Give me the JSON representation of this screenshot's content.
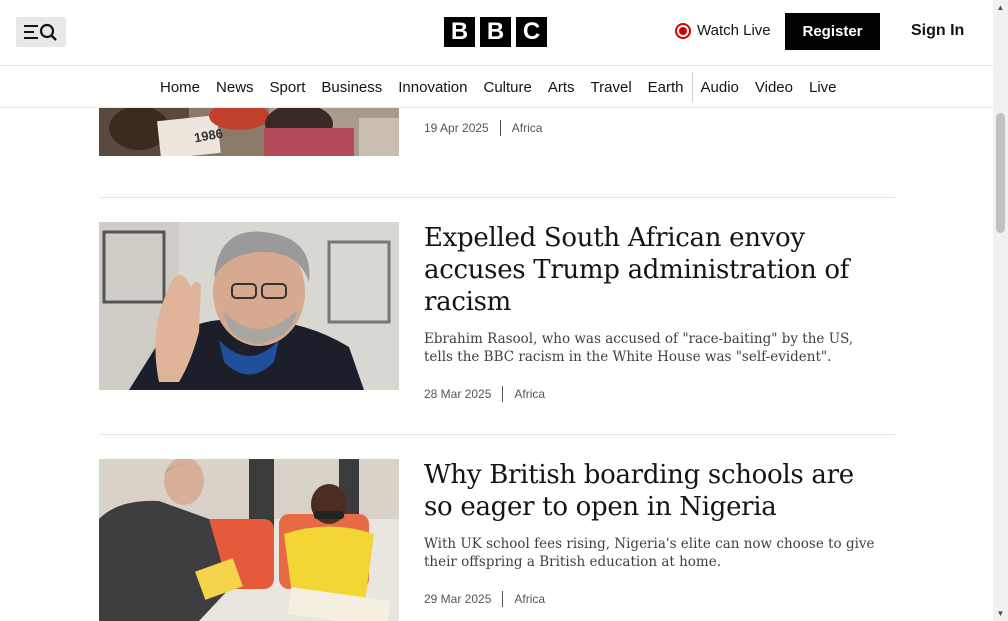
{
  "header": {
    "logo_letters": [
      "B",
      "B",
      "C"
    ],
    "watch_live": "Watch Live",
    "register": "Register",
    "sign_in": "Sign In"
  },
  "nav": {
    "items": [
      "Home",
      "News",
      "Sport",
      "Business",
      "Innovation",
      "Culture",
      "Arts",
      "Travel",
      "Earth",
      "Audio",
      "Video",
      "Live"
    ]
  },
  "articles": [
    {
      "date": "19 Apr 2025",
      "section": "Africa",
      "image_label": "1986"
    },
    {
      "headline": "Expelled South African envoy accuses Trump administration of racism",
      "summary": "Ebrahim Rasool, who was accused of \"race-baiting\" by the US, tells the BBC racism in the White House was \"self-evident\".",
      "date": "28 Mar 2025",
      "section": "Africa"
    },
    {
      "headline": "Why British boarding schools are so eager to open in Nigeria",
      "summary": "With UK school fees rising, Nigeria's elite can now choose to give their offspring a British education at home.",
      "date": "29 Mar 2025",
      "section": "Africa"
    }
  ]
}
